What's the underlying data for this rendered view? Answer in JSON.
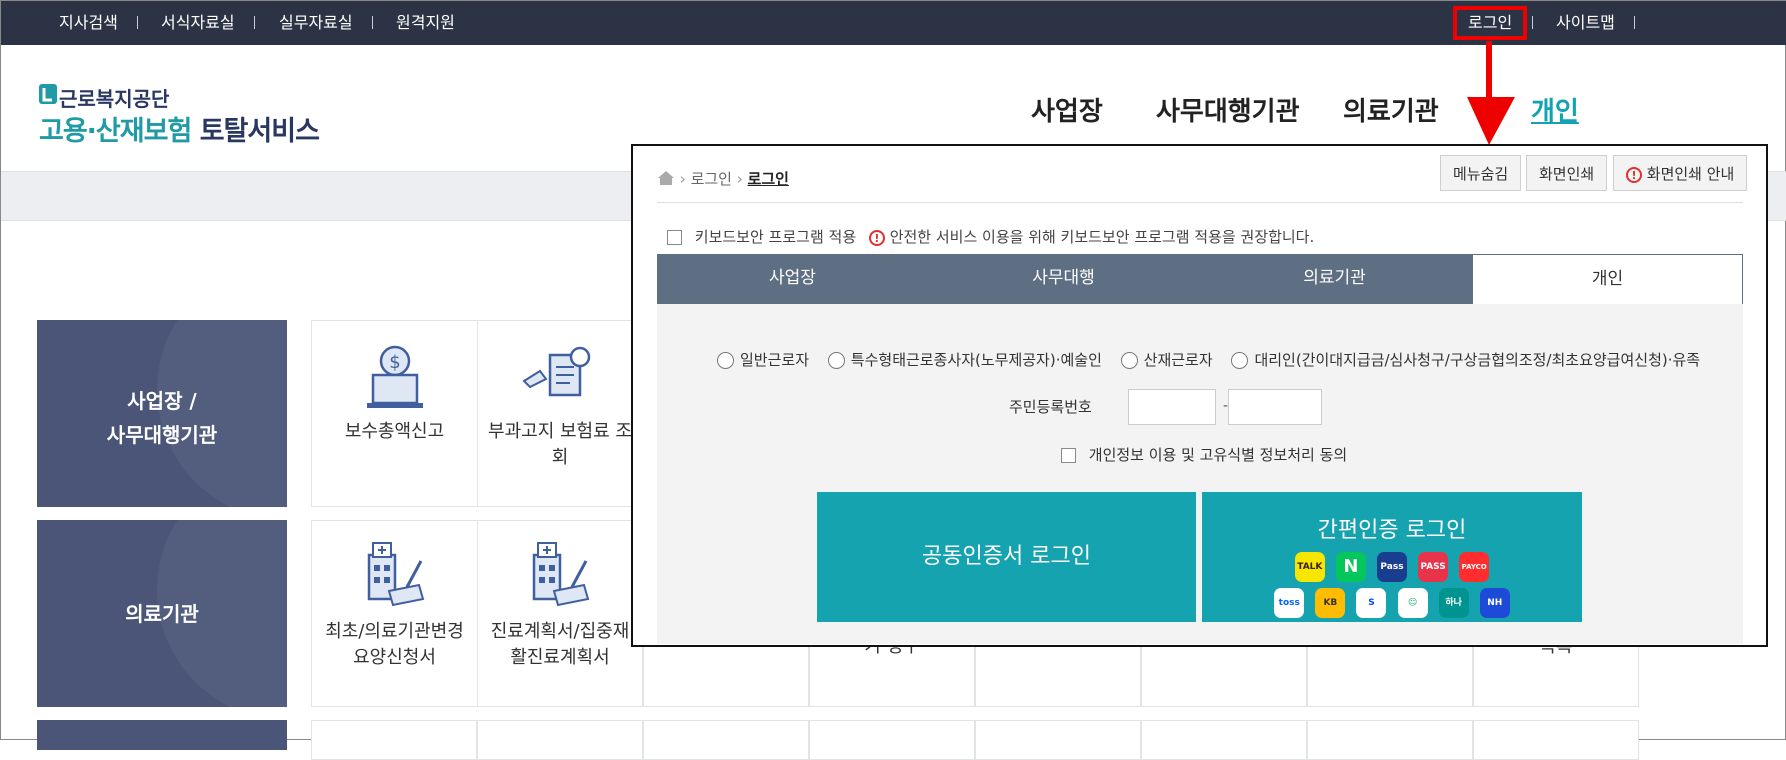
{
  "topbar": {
    "links": [
      "지사검색",
      "서식자료실",
      "실무자료실",
      "원격지원"
    ],
    "login": "로그인",
    "sitemap": "사이트맵"
  },
  "logo": {
    "org": "근로복지공단",
    "service_accent": "고용·산재보험",
    "service_rest": "토탈서비스"
  },
  "gnb": [
    "사업장",
    "사무대행기관",
    "의료기관",
    "개인"
  ],
  "categories": {
    "business": [
      "사업장 /",
      "사무대행기관"
    ],
    "medical": "의료기관"
  },
  "business_items": [
    {
      "label": "보수총액신고",
      "icon": "money-laptop-icon"
    },
    {
      "label": "부과고지 보험료 조회",
      "line1": "부과고지 보험료 조",
      "line2": "회",
      "icon": "document-search-icon"
    }
  ],
  "medical_items": [
    {
      "line1": "최초/의료기관변경",
      "line2": "요양신청서",
      "icon": "hospital-form-icon"
    },
    {
      "line1": "진료계획서/집중재",
      "line2": "활진료계획서",
      "icon": "hospital-form-icon"
    }
  ],
  "partial_items": [
    "기 청구",
    "목록"
  ],
  "modal": {
    "breadcrumb": [
      "로그인",
      "로그인"
    ],
    "buttons": {
      "hide_menu": "메뉴숨김",
      "print": "화면인쇄",
      "print_guide": "화면인쇄 안내"
    },
    "keyboard_security": "키보드보안 프로그램 적용",
    "keyboard_notice": "안전한 서비스 이용을 위해 키보드보안 프로그램 적용을 권장합니다.",
    "tabs": [
      "사업장",
      "사무대행",
      "의료기관",
      "개인"
    ],
    "active_tab": "개인",
    "radio_options": [
      "일반근로자",
      "특수형태근로종사자(노무제공자)·예술인",
      "산재근로자",
      "대리인(간이대지급금/심사청구/구상금협의조정/최초요양급여신청)·유족"
    ],
    "rrn_label": "주민등록번호",
    "rrn_separator": "-",
    "consent": "개인정보 이용 및 고유식별 정보처리 동의",
    "cert_login": "공동인증서 로그인",
    "simple_login": "간편인증 로그인",
    "simple_providers": [
      "TALK",
      "N",
      "Pass",
      "PASS",
      "PAYCO",
      "toss",
      "KB",
      "S",
      "☺",
      "하나",
      "NH"
    ]
  },
  "colors": {
    "topbar": "#2c3345",
    "accent": "#16a3b0",
    "category": "#4a5577",
    "tabbar": "#5e6e83",
    "highlight": "#ee0000"
  }
}
